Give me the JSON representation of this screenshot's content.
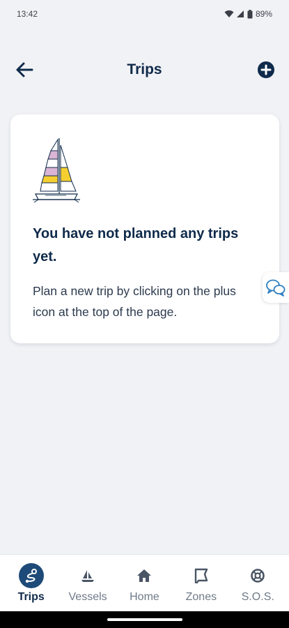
{
  "status_bar": {
    "time": "13:42",
    "battery": "89%",
    "icons": [
      "wifi-icon",
      "signal-icon",
      "battery-icon"
    ]
  },
  "header": {
    "title": "Trips",
    "back_icon": "arrow-left-icon",
    "add_icon": "plus-circle-icon"
  },
  "empty_state": {
    "illustration": "sailboat-illustration",
    "heading": "You have not planned any trips yet.",
    "body": "Plan a new trip by clicking on the plus icon at the top of the page."
  },
  "chat_fab": {
    "icon": "chat-bubbles-icon"
  },
  "bottom_nav": {
    "active": "Trips",
    "items": [
      {
        "label": "Trips",
        "icon": "trips-route-icon"
      },
      {
        "label": "Vessels",
        "icon": "sailboat-icon"
      },
      {
        "label": "Home",
        "icon": "home-icon"
      },
      {
        "label": "Zones",
        "icon": "zone-flag-icon"
      },
      {
        "label": "S.O.S.",
        "icon": "lifebuoy-icon"
      }
    ]
  },
  "colors": {
    "navy": "#0f2a4a",
    "active_nav_bg": "#1d4a78",
    "page_bg": "#f1f2f6",
    "inactive_nav": "#6f7a88",
    "sail_pink": "#d9b4d4",
    "sail_yellow": "#f5cf2f"
  }
}
